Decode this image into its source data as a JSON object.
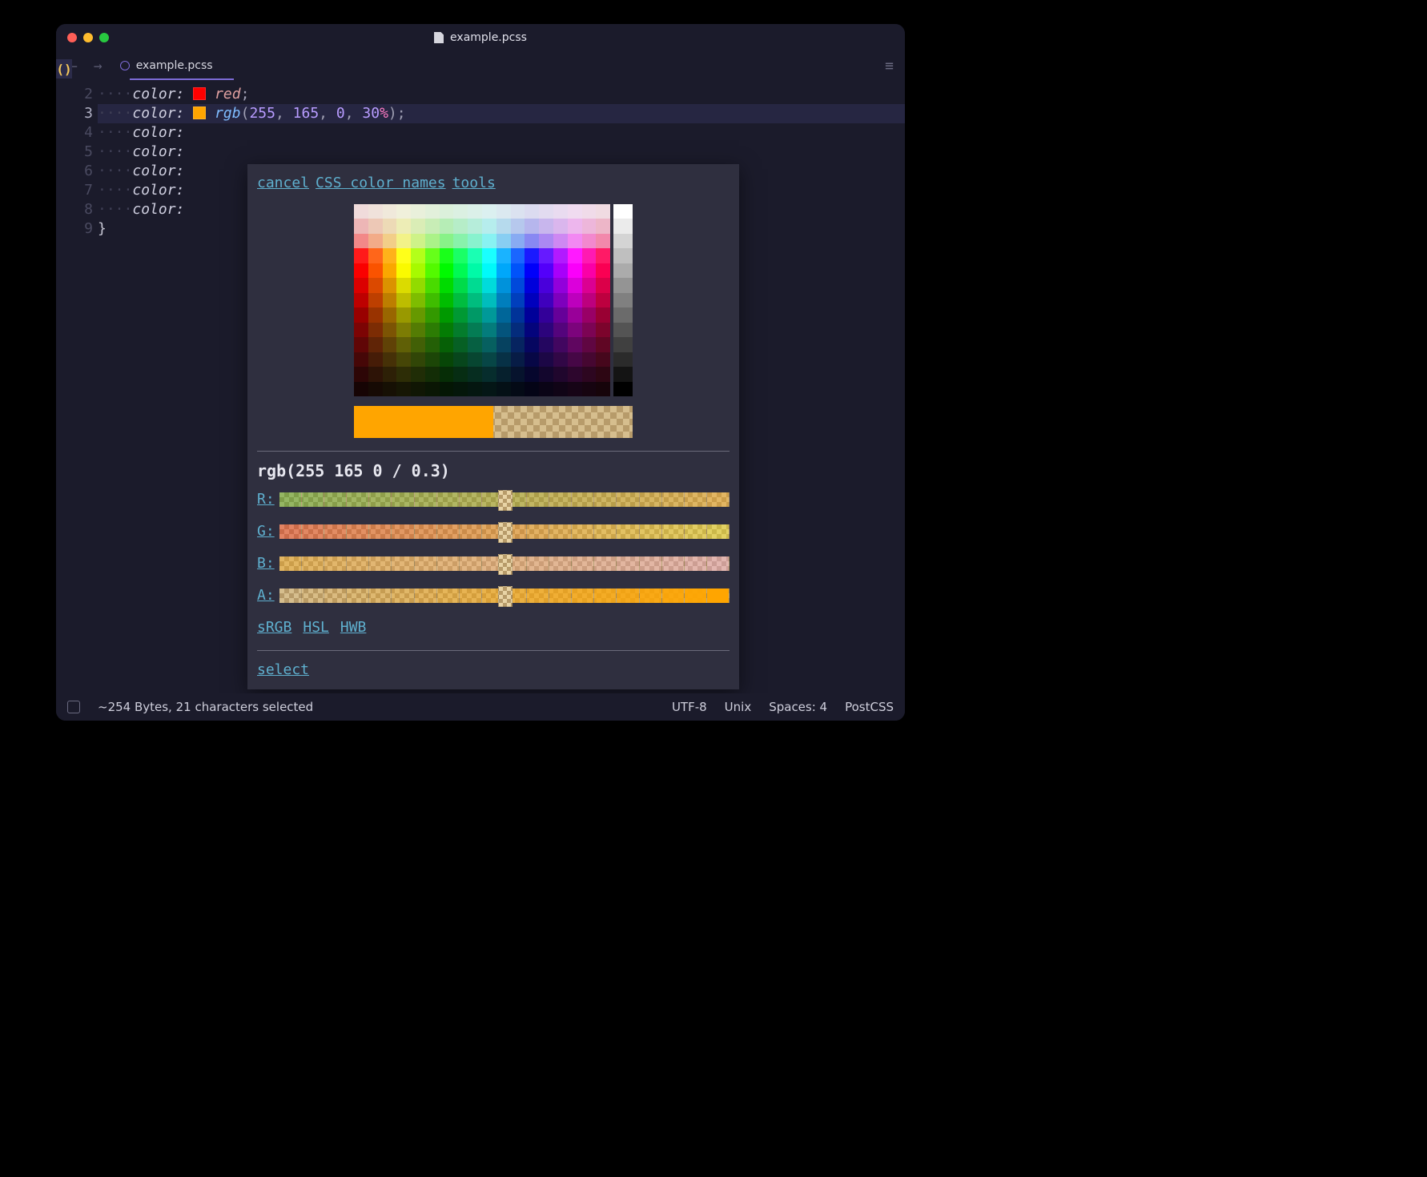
{
  "titlebar": {
    "filename": "example.pcss"
  },
  "tab": {
    "filename": "example.pcss"
  },
  "gutter": {
    "start": 2,
    "current": 3,
    "lines": [
      2,
      3,
      4,
      5,
      6,
      7,
      8,
      9
    ]
  },
  "code": {
    "prev_prop": "color:",
    "prev_val": "red",
    "prop": "color:",
    "fn": "rgb",
    "r": "255",
    "g": "165",
    "b": "0",
    "a": "30",
    "pct": "%",
    "swatch_current": "#ffa500",
    "swatch_prev": "#ff0000",
    "rest_prop": "color:",
    "closing": "}"
  },
  "popup": {
    "links": {
      "cancel": "cancel",
      "names": "CSS color names",
      "tools": "tools"
    },
    "value_string": "rgb(255 165 0 / 0.3)",
    "channels": {
      "R": {
        "label": "R:",
        "knob_pct": 50
      },
      "G": {
        "label": "G:",
        "knob_pct": 50
      },
      "B": {
        "label": "B:",
        "knob_pct": 50
      },
      "A": {
        "label": "A:",
        "knob_pct": 50
      }
    },
    "spaces": {
      "srgb": "sRGB",
      "hsl": "HSL",
      "hwb": "HWB"
    },
    "select": "select"
  },
  "status": {
    "size": "~254 Bytes, 21 characters selected",
    "encoding": "UTF-8",
    "eol": "Unix",
    "indent": "Spaces: 4",
    "lang": "PostCSS"
  },
  "colors": {
    "accent": "#ffa500"
  }
}
